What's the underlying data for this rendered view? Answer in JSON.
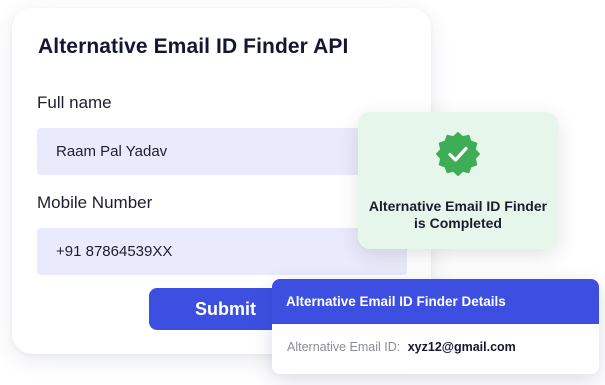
{
  "form": {
    "title": "Alternative Email ID Finder API",
    "full_name_label": "Full name",
    "full_name_value": "Raam Pal Yadav",
    "mobile_label": "Mobile Number",
    "mobile_value": "+91 87864539XX",
    "submit_label": "Submit"
  },
  "status": {
    "icon": "check-badge-icon",
    "message": "Alternative Email ID Finder is Completed",
    "color": "#3dae57"
  },
  "details": {
    "header": "Alternative Email ID Finder Details",
    "field_label": "Alternative Email ID:",
    "field_value": "xyz12@gmail.com"
  },
  "colors": {
    "accent": "#3c4fe0",
    "input_bg": "#e9eafb",
    "success_bg": "#e7f6ea"
  }
}
